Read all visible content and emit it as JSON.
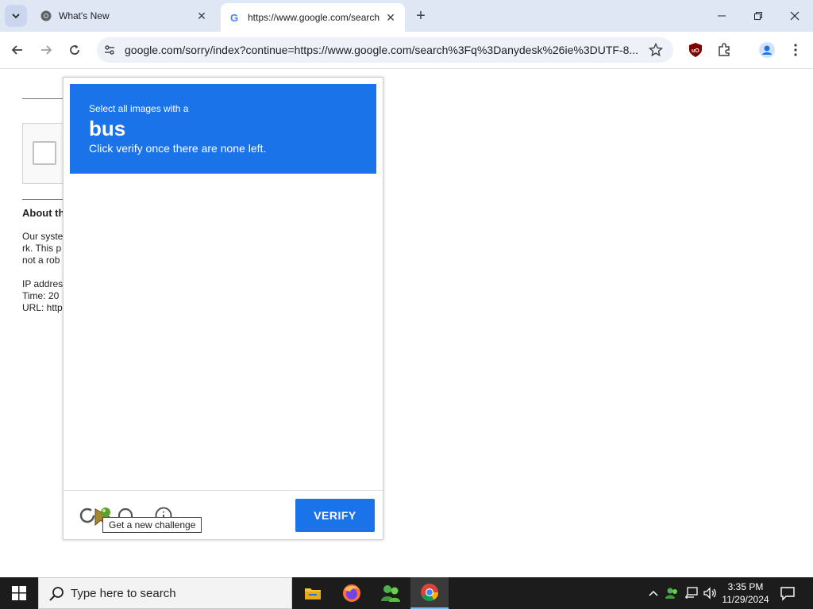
{
  "browser": {
    "tabs": [
      {
        "title": "What's New",
        "active": false
      },
      {
        "title": "https://www.google.com/search",
        "active": true
      }
    ],
    "url": "google.com/sorry/index?continue=https://www.google.com/search%3Fq%3Danydesk%26ie%3DUTF-8..."
  },
  "background_page": {
    "about_heading": "About th",
    "para1_l1": "Our syste",
    "para1_l2": "rk. This p",
    "para1_l3": "not a rob",
    "ip_line": "IP addres",
    "time_line": "Time: 20",
    "url_line": "URL: http"
  },
  "captcha": {
    "instruction_line1": "Select all images with a",
    "target_word": "bus",
    "instruction_line3": "Click verify once there are none left.",
    "verify_label": "VERIFY",
    "tooltip": "Get a new challenge",
    "header_color": "#1a73e8"
  },
  "taskbar": {
    "search_placeholder": "Type here to search",
    "time": "3:35 PM",
    "date": "11/29/2024"
  }
}
